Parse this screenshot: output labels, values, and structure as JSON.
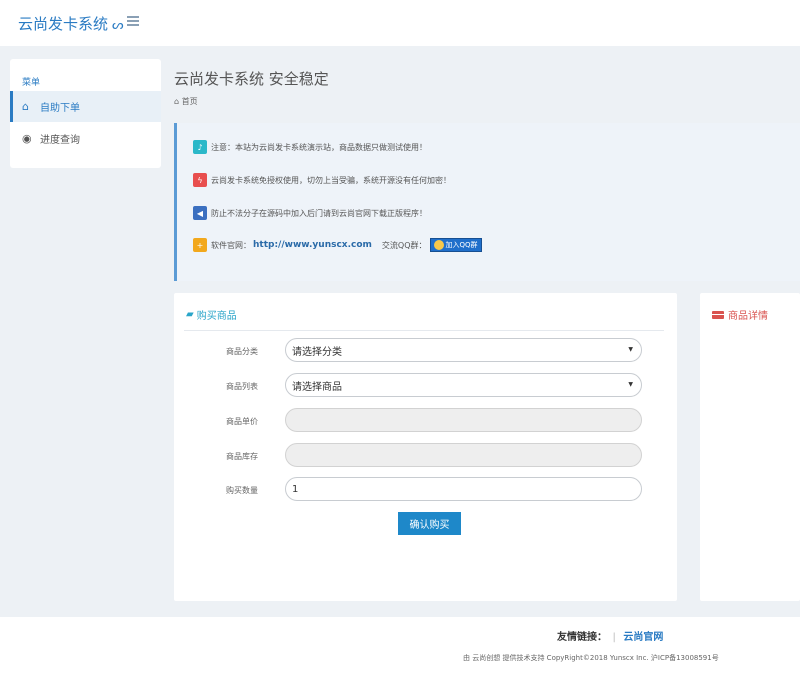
{
  "header": {
    "brand": "云尚发卡系统",
    "brand_icon": "infinity-icon",
    "menu_icon": "list-icon"
  },
  "sidebar": {
    "title": "菜单",
    "items": [
      {
        "label": "自助下单",
        "icon": "home-icon",
        "active": true
      },
      {
        "label": "进度查询",
        "icon": "eye-icon",
        "active": false
      }
    ]
  },
  "main": {
    "title": "云尚发卡系统 安全稳定",
    "breadcrumb": "首页"
  },
  "notices": [
    {
      "icon": "bell-icon",
      "color": "#2bb8c9",
      "text": "注意：本站为云尚发卡系统演示站，商品数据只做测试使用！"
    },
    {
      "icon": "bolt-icon",
      "color": "#e84e4e",
      "text": "云尚发卡系统免授权使用，切勿上当受骗，系统开源没有任何加密！"
    },
    {
      "icon": "megaphone-icon",
      "color": "#3b6fc0",
      "text": "防止不法分子在源码中加入后门请到云尚官网下载正版程序！"
    },
    {
      "icon": "plus-icon",
      "color": "#f2a81d",
      "label": "软件官网：",
      "site": "http://www.yunscx.com",
      "qq_label": "交流QQ群：",
      "qq_button": "加入QQ群"
    }
  ],
  "buy": {
    "title": "购买商品",
    "fields": [
      {
        "label": "商品分类",
        "value": "请选择分类",
        "type": "select"
      },
      {
        "label": "商品列表",
        "value": "请选择商品",
        "type": "select"
      },
      {
        "label": "商品单价",
        "value": "",
        "type": "disabled"
      },
      {
        "label": "商品库存",
        "value": "",
        "type": "disabled"
      },
      {
        "label": "购买数量",
        "value": "1",
        "type": "input"
      }
    ],
    "confirm": "确认购买"
  },
  "detail": {
    "title": "商品详情"
  },
  "footer": {
    "friend_label": "友情链接：",
    "friend_link": "云尚官网",
    "copyright": "由 云尚创想 提供技术支持   CopyRight©2018 Yunscx Inc.   沪ICP备13008591号"
  }
}
